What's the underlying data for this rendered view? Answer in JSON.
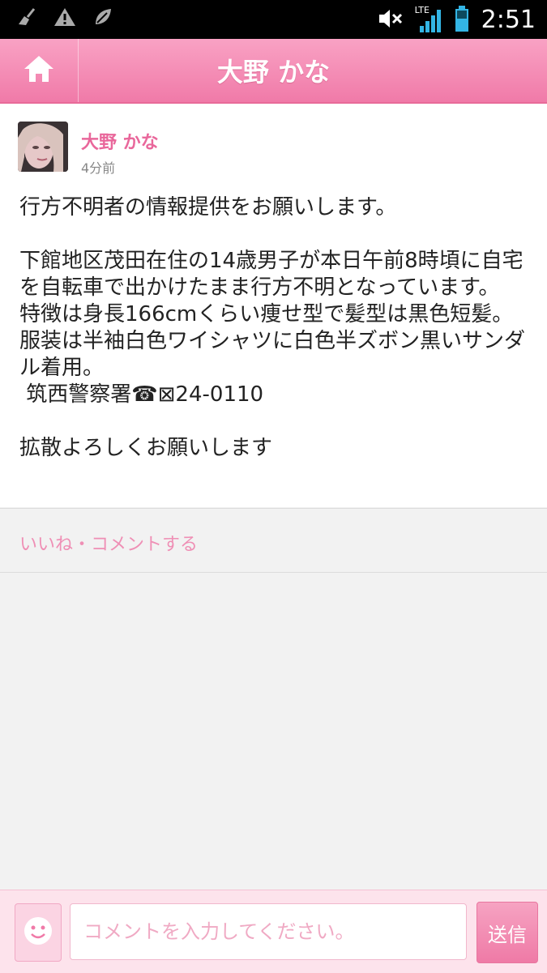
{
  "status_bar": {
    "time": "2:51",
    "network": "LTE",
    "icons": [
      "broom-icon",
      "warning-icon",
      "leaf-icon",
      "mute-icon",
      "signal-icon",
      "battery-icon"
    ]
  },
  "header": {
    "title": "大野 かな",
    "home_icon": "home-icon"
  },
  "post": {
    "author": "大野 かな",
    "time_ago": "4分前",
    "paragraphs": [
      "行方不明者の情報提供をお願いします。",
      "",
      "下館地区茂田在住の14歳男子が本日午前8時頃に自宅を自転車で出かけたまま行方不明となっています。\n特徴は身長166cmくらい痩せ型で髪型は黒色短髪。服装は半袖白色ワイシャツに白色半ズボン黒いサンダル着用。\n 筑西警察署☎︎⊠24-0110",
      "",
      "拡散よろしくお願いします"
    ]
  },
  "actions": {
    "like_comment_label": "いいね・コメントする"
  },
  "comment_bar": {
    "placeholder": "コメントを入力してください。",
    "send_label": "送信",
    "emoji_icon": "smiley-icon"
  },
  "colors": {
    "accent": "#f07aa8",
    "author": "#e9679b",
    "action_text": "#ef8fb5"
  }
}
